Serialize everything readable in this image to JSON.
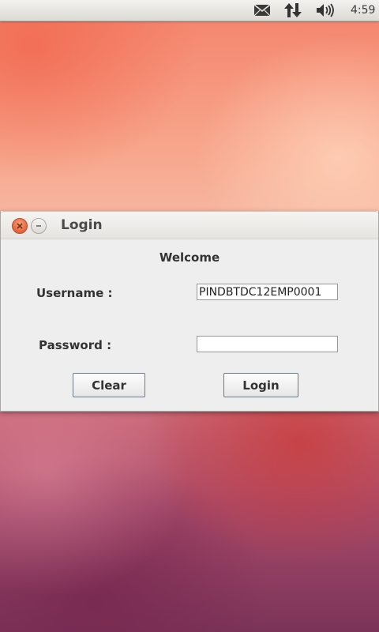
{
  "panel": {
    "icons": [
      "mail-icon",
      "network-arrows-icon",
      "volume-icon"
    ],
    "clock": "4:59"
  },
  "window": {
    "title": "Login",
    "controls": [
      "close-icon",
      "minimize-icon"
    ],
    "close_color": "#e86a3f"
  },
  "form": {
    "heading": "Welcome",
    "username_label": "Username :",
    "username_value": "PINDBTDC12EMP0001",
    "password_label": "Password :",
    "password_value": "",
    "clear_label": "Clear",
    "login_label": "Login"
  }
}
